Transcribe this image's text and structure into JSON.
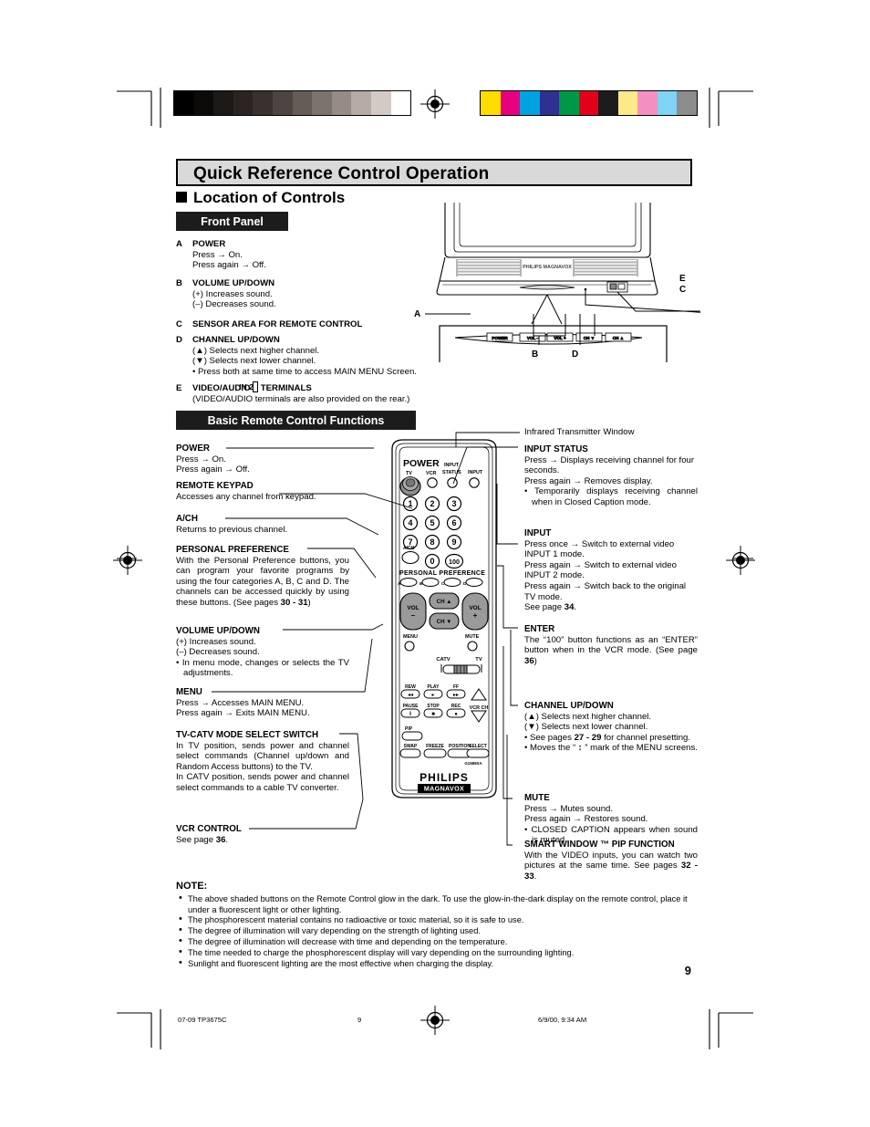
{
  "document": {
    "title": "Quick Reference Control Operation",
    "section_heading": "Location of Controls",
    "page_number": "9"
  },
  "front_panel": {
    "bar_label": "Front Panel",
    "items": [
      {
        "key": "A",
        "label": "POWER",
        "lines": [
          "Press → On.",
          "Press again → Off."
        ]
      },
      {
        "key": "B",
        "label": "VOLUME UP/DOWN",
        "lines": [
          "(+) Increases sound.",
          "(–) Decreases sound."
        ]
      },
      {
        "key": "C",
        "label": "SENSOR AREA FOR REMOTE CONTROL",
        "lines": []
      },
      {
        "key": "D",
        "label": "CHANNEL UP/DOWN",
        "lines": [
          "(▲) Selects next higher channel.",
          "(▼) Selects next lower channel.",
          "• Press both at same time to access MAIN MENU Screen."
        ]
      },
      {
        "key": "E",
        "label_pre": "VIDEO/AUDIO",
        "label_box": "IN 2",
        "label_post": "TERMINALS",
        "lines": [
          "(VIDEO/AUDIO terminals are also provided on the rear.)"
        ]
      }
    ],
    "callouts": [
      "A",
      "B",
      "C",
      "D",
      "E"
    ],
    "tv_buttons": [
      "POWER",
      "VOL -",
      "VOL +",
      "CH ▼",
      "CH ▲"
    ],
    "tv_brand": "PHILIPS MAGNAVOX"
  },
  "remote_section": {
    "bar_label": "Basic Remote Control Functions"
  },
  "left_column": [
    {
      "heading": "POWER",
      "body": [
        "Press → On.",
        "Press again → Off."
      ]
    },
    {
      "heading": "REMOTE KEYPAD",
      "body": [
        "Accesses any channel from keypad."
      ]
    },
    {
      "heading": "A/CH",
      "body": [
        "Returns to previous channel."
      ]
    },
    {
      "heading": "PERSONAL PREFERENCE",
      "body": [
        "With the Personal Preference buttons, you can program your favorite programs by using the four categories A, B, C and D. The channels can be accessed quickly by using these buttons. (See pages 30 - 31)"
      ],
      "bold_tokens": [
        "30 - 31"
      ]
    },
    {
      "heading": "VOLUME UP/DOWN",
      "body": [
        "(+) Increases sound.",
        "(–) Decreases sound."
      ],
      "bullets": [
        "In menu mode, changes or selects the TV adjustments."
      ]
    },
    {
      "heading": "MENU",
      "body": [
        "Press → Accesses MAIN MENU.",
        "Press again → Exits MAIN MENU."
      ]
    },
    {
      "heading": "TV-CATV MODE SELECT SWITCH",
      "body": [
        "In TV position, sends power and channel select commands (Channel up/down and Random Access buttons) to the TV.",
        "In CATV position, sends power and channel select commands to a cable TV converter."
      ]
    },
    {
      "heading": "VCR CONTROL",
      "body": [
        "See page 36."
      ],
      "bold_tokens": [
        "36"
      ]
    }
  ],
  "right_column": [
    {
      "heading": "",
      "plain_heading": "Infrared Transmitter Window",
      "body": []
    },
    {
      "heading": "INPUT STATUS",
      "body": [
        "Press → Displays receiving channel for four seconds.",
        "Press again → Removes display."
      ],
      "bullets": [
        "Temporarily displays receiving channel when in Closed Caption mode."
      ]
    },
    {
      "heading": "INPUT",
      "body": [
        "Press once → Switch to external video INPUT 1 mode.",
        "Press again → Switch to external video INPUT 2 mode.",
        "Press again → Switch back to the original TV mode.",
        "See page 34."
      ],
      "bold_tokens": [
        "34"
      ]
    },
    {
      "heading": "ENTER",
      "body": [
        "The “100” button functions as an “ENTER” button when in the VCR mode. (See page 36)"
      ],
      "bold_tokens": [
        "36"
      ]
    },
    {
      "heading": "CHANNEL UP/DOWN",
      "body": [
        "(▲) Selects next higher channel.",
        "(▼) Selects next lower channel."
      ],
      "bullets": [
        "See pages 27 - 29 for channel presetting.",
        "Moves the “ ↕ ” mark of the MENU screens."
      ],
      "bold_tokens": [
        "27 - 29"
      ]
    },
    {
      "heading": "MUTE",
      "body": [
        "Press → Mutes sound.",
        "Press again → Restores sound."
      ],
      "bullets": [
        "CLOSED CAPTION appears when sound is muted."
      ]
    },
    {
      "heading": "SMART WINDOW ™ PIP FUNCTION",
      "body": [
        "With the VIDEO inputs, you can watch two pictures at the same time. See pages 32 - 33."
      ],
      "bold_tokens": [
        "32 - 33"
      ]
    }
  ],
  "remote_diagram": {
    "power_label": "POWER",
    "power_tv": "TV",
    "power_vcr": "VCR",
    "input_status": "INPUT STATUS",
    "input": "INPUT",
    "keypad": [
      "1",
      "2",
      "3",
      "4",
      "5",
      "6",
      "7",
      "8",
      "9",
      "0",
      "100"
    ],
    "ach_label": "A/CH",
    "personal_preference": "PERSONAL PREFERENCE",
    "pp_letters": [
      "A",
      "B",
      "C",
      "D"
    ],
    "vol_down": "VOL –",
    "vol_up": "VOL +",
    "ch_up": "CH ▲",
    "ch_down": "CH ▼",
    "menu": "MENU",
    "mute": "MUTE",
    "switch_catv": "CATV",
    "switch_tv": "TV",
    "vcr_row1": [
      "REW",
      "PLAY",
      "FF"
    ],
    "vcr_row1_glyph": [
      "◂◂",
      "▸",
      "▸▸"
    ],
    "vcr_row2": [
      "PAUSE",
      "STOP",
      "REC"
    ],
    "vcr_row2_glyph": [
      "‖",
      "■",
      "●"
    ],
    "vcr_ch": "VCR CH",
    "pip": "PIP",
    "bottom_row": [
      "SWAP",
      "FREEZE",
      "POSITION",
      "SELECT"
    ],
    "model_code": "G1589SA",
    "brand_top": "PHILIPS",
    "brand_bottom": "MAGNAVOX"
  },
  "note": {
    "title": "NOTE:",
    "items": [
      "The above shaded buttons on the Remote Control glow in the dark. To use the glow-in-the-dark display on the remote control, place it under a fluorescent light or other lighting.",
      "The phosphorescent material contains no radioactive or toxic material, so it is safe to use.",
      "The degree of illumination will vary depending on the strength of lighting used.",
      "The degree of illumination will decrease with time and depending on the temperature.",
      "The time needed to charge the phosphorescent display will vary depending on the surrounding lighting.",
      "Sunlight and fluorescent lighting are the most effective when charging the display."
    ]
  },
  "footer": {
    "left": "07-09 TP3675C",
    "center": "9",
    "right": "6/9/00, 9:34 AM"
  },
  "print_marks": {
    "grayscale_bars": [
      "#000000",
      "#0d0b0a",
      "#1d1917",
      "#2a2523",
      "#38312d",
      "#4d4541",
      "#655c57",
      "#7d736d",
      "#968b85",
      "#b6aba5",
      "#d4cac5",
      "#ffffff"
    ],
    "color_bars": [
      "#ffdd00",
      "#e6007e",
      "#00a3e0",
      "#2e3192",
      "#009846",
      "#e2001a",
      "#1c1c1c",
      "#fbe98a",
      "#f490c0",
      "#7fd4f5",
      "#8c8c8c"
    ]
  }
}
